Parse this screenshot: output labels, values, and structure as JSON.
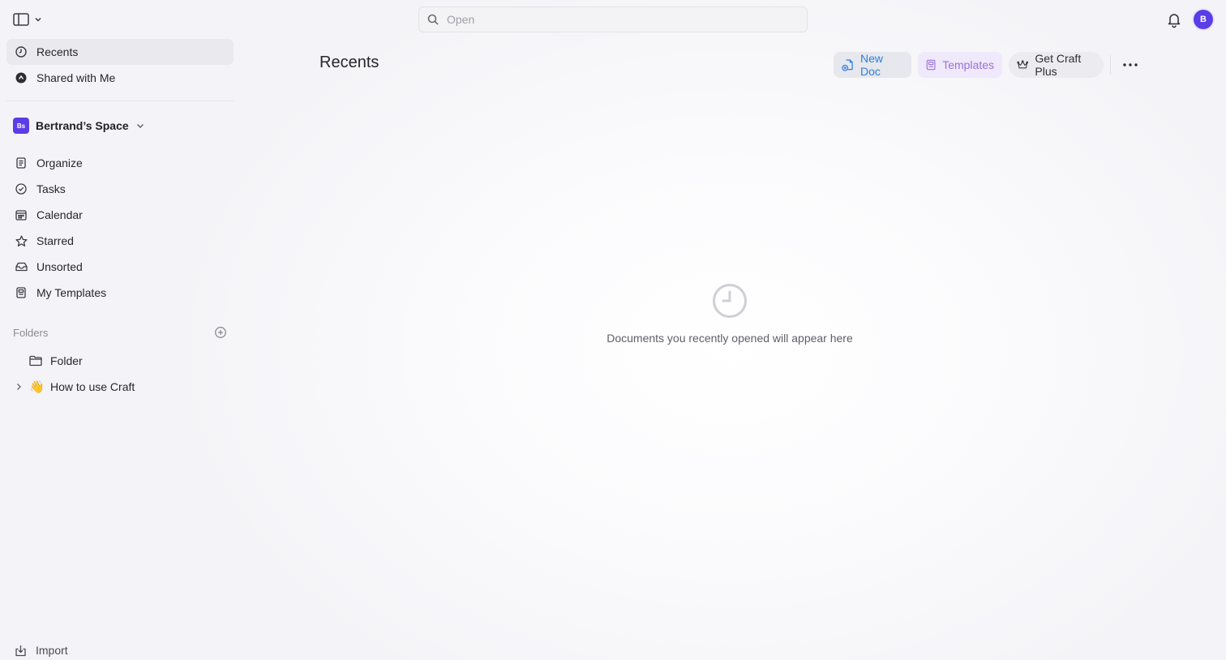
{
  "topbar": {
    "search_placeholder": "Open",
    "avatar_initial": "B"
  },
  "sidebar": {
    "top_items": [
      {
        "label": "Recents",
        "icon": "clock-icon",
        "active": true
      },
      {
        "label": "Shared with Me",
        "icon": "shared-icon",
        "active": false
      }
    ],
    "space": {
      "badge": "Bs",
      "name": "Bertrand’s Space"
    },
    "space_items": [
      {
        "label": "Organize",
        "icon": "document-list-icon"
      },
      {
        "label": "Tasks",
        "icon": "check-circle-icon"
      },
      {
        "label": "Calendar",
        "icon": "calendar-icon"
      },
      {
        "label": "Starred",
        "icon": "star-icon"
      },
      {
        "label": "Unsorted",
        "icon": "inbox-icon"
      },
      {
        "label": "My Templates",
        "icon": "template-icon"
      }
    ],
    "folders_label": "Folders",
    "folders": [
      {
        "label": "Folder",
        "icon": "folder-icon"
      },
      {
        "label": "How to use Craft",
        "icon": "waving-hand-emoji",
        "emoji": "👋",
        "expandable": true
      }
    ],
    "import_label": "Import"
  },
  "main": {
    "title": "Recents",
    "buttons": {
      "new_doc": "New Doc",
      "templates": "Templates",
      "get_plus": "Get Craft Plus"
    },
    "empty_text": "Documents you recently opened will appear here"
  },
  "colors": {
    "accent_purple": "#5b3de8",
    "new_doc_blue": "#2f7de1",
    "templates_purple": "#9a70d9"
  }
}
